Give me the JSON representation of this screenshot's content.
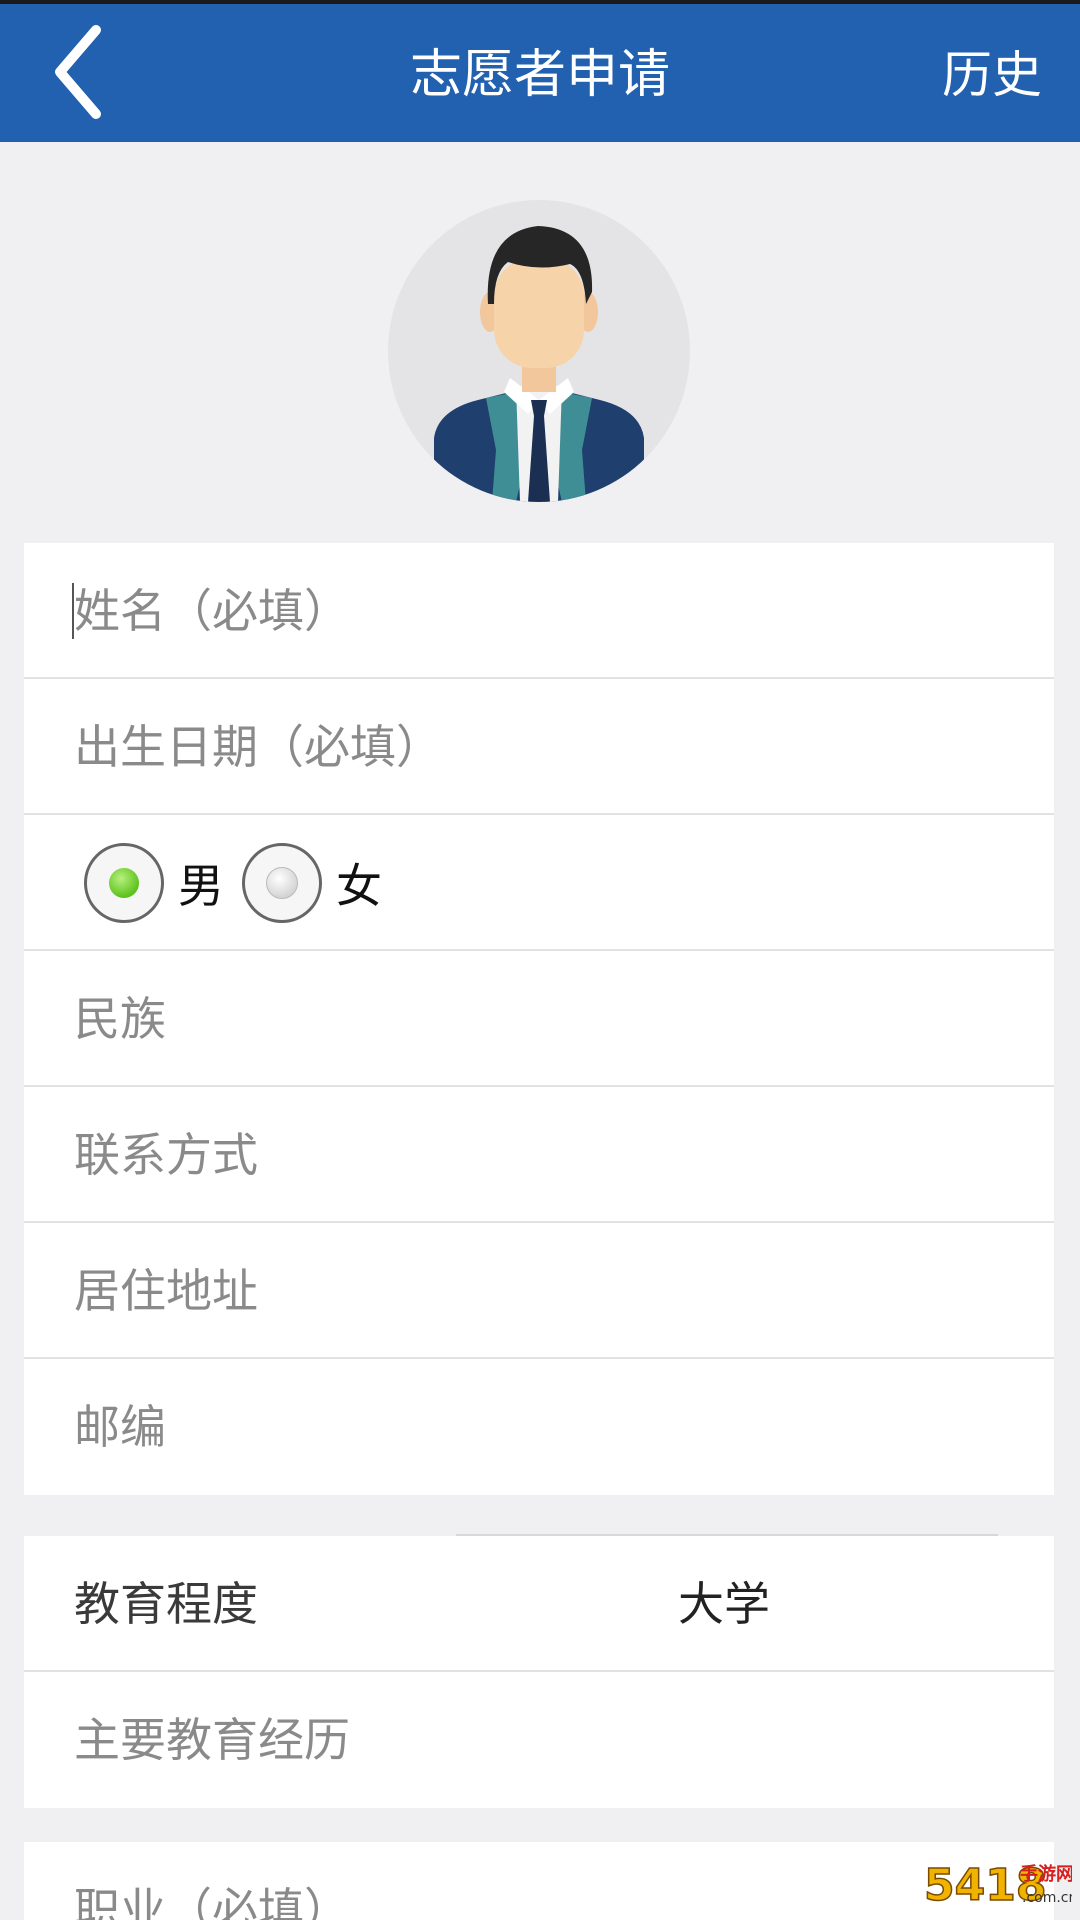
{
  "header": {
    "title": "志愿者申请",
    "history_label": "历史",
    "background": "#2260b0"
  },
  "form": {
    "name_placeholder": "姓名（必填）",
    "birthdate_placeholder": "出生日期（必填）",
    "gender": {
      "male_label": "男",
      "female_label": "女",
      "selected": "男"
    },
    "ethnicity_placeholder": "民族",
    "contact_placeholder": "联系方式",
    "address_placeholder": "居住地址",
    "postcode_placeholder": "邮编",
    "education_label": "教育程度",
    "education_value": "大学",
    "education_history_placeholder": "主要教育经历",
    "occupation_placeholder": "职业（必填）"
  },
  "icons": {
    "back": "chevron-left-icon",
    "avatar": "user-avatar-icon"
  },
  "watermark": {
    "text": "5418",
    "subtext": "手游网",
    "domain": ".com.cn"
  }
}
